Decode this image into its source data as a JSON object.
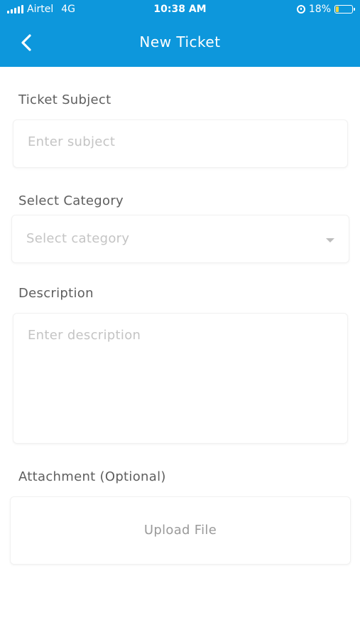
{
  "status_bar": {
    "carrier": "Airtel",
    "network": "4G",
    "time": "10:38 AM",
    "battery": "18%",
    "battery_level": 0.18,
    "battery_color": "#f2d23c"
  },
  "header": {
    "title": "New Ticket",
    "back_icon": "chevron-left-icon",
    "background": "#0d97dc"
  },
  "form": {
    "subject": {
      "label": "Ticket Subject",
      "placeholder": "Enter subject",
      "value": ""
    },
    "category": {
      "label": "Select Category",
      "placeholder": "Select category",
      "selected": ""
    },
    "description": {
      "label": "Description",
      "placeholder": "Enter description",
      "value": ""
    },
    "attachment": {
      "label": "Attachment (Optional)",
      "button_label": "Upload File"
    }
  }
}
